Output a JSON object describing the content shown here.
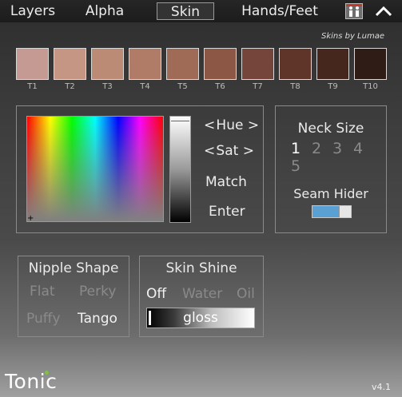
{
  "tabs": {
    "layers": "Layers",
    "alpha": "Alpha",
    "skin": "Skin",
    "hands_feet": "Hands/Feet",
    "icon": "outfit-icon",
    "collapse_icon": "chevron-up-icon"
  },
  "skins": {
    "credit": "Skins by Lumae",
    "items": [
      {
        "label": "T1",
        "color": "#c49a92"
      },
      {
        "label": "T2",
        "color": "#c59683"
      },
      {
        "label": "T3",
        "color": "#bb8b76"
      },
      {
        "label": "T4",
        "color": "#b07b67"
      },
      {
        "label": "T5",
        "color": "#9f6a56"
      },
      {
        "label": "T6",
        "color": "#8c5744"
      },
      {
        "label": "T7",
        "color": "#75443a"
      },
      {
        "label": "T8",
        "color": "#5e3528"
      },
      {
        "label": "T9",
        "color": "#46271d"
      },
      {
        "label": "T10",
        "color": "#2f1c16"
      }
    ]
  },
  "color_picker": {
    "hue": "Hue",
    "sat": "Sat",
    "match": "Match",
    "enter": "Enter",
    "left_arrow": "<",
    "right_arrow": ">"
  },
  "neck": {
    "title": "Neck Size",
    "sizes": [
      "1",
      "2",
      "3",
      "4",
      "5"
    ],
    "selected": "1"
  },
  "seam": {
    "title": "Seam Hider",
    "enabled": true
  },
  "nipple": {
    "title": "Nipple Shape",
    "options": [
      "Flat",
      "Perky",
      "Puffy",
      "Tango"
    ],
    "selected": "Tango"
  },
  "shine": {
    "title": "Skin Shine",
    "options": [
      "Off",
      "Water",
      "Oil"
    ],
    "selected": "Off",
    "slider_label": "gloss"
  },
  "footer": {
    "logo": "Tonic",
    "version": "v4.1"
  }
}
